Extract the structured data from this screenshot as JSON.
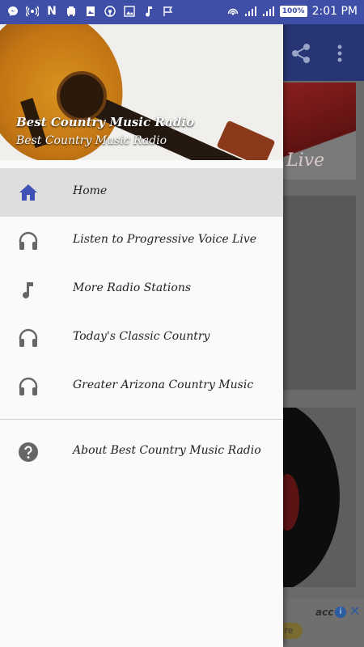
{
  "status_bar": {
    "left_icons": [
      "messenger-icon",
      "radio-icon",
      "n-icon",
      "train-icon",
      "photo-icon",
      "broadcast-icon",
      "image-icon",
      "music-note-icon",
      "flag-icon"
    ],
    "right_icons": [
      "hotspot-icon",
      "signal-icon",
      "signal-icon",
      "battery-icon"
    ],
    "battery": "100%",
    "time": "2:01 PM"
  },
  "drawer": {
    "header": {
      "title": "Best Country Music Radio",
      "subtitle": "Best Country Music Radio"
    },
    "items": [
      {
        "label": "Home",
        "icon": "home-icon",
        "active": true
      },
      {
        "label": "Listen to Progressive Voice Live",
        "icon": "headphones-icon",
        "active": false
      },
      {
        "label": "More Radio Stations",
        "icon": "music-note-icon",
        "active": false
      },
      {
        "label": "Today's Classic Country",
        "icon": "headphones-icon",
        "active": false
      },
      {
        "label": "Greater Arizona Country Music",
        "icon": "headphones-icon",
        "active": false
      }
    ],
    "footer_items": [
      {
        "label": "About Best Country Music Radio",
        "icon": "help-icon"
      }
    ]
  },
  "background": {
    "toolbar_icons": [
      "share-icon",
      "more-vert-icon"
    ],
    "card_text": "Live",
    "ad_text": "acc",
    "ad_button": "re"
  },
  "colors": {
    "status_bar": "#3f4fa8",
    "accent": "#3f51b5",
    "icon_gray": "#666666",
    "active_item_bg": "#dedede"
  }
}
